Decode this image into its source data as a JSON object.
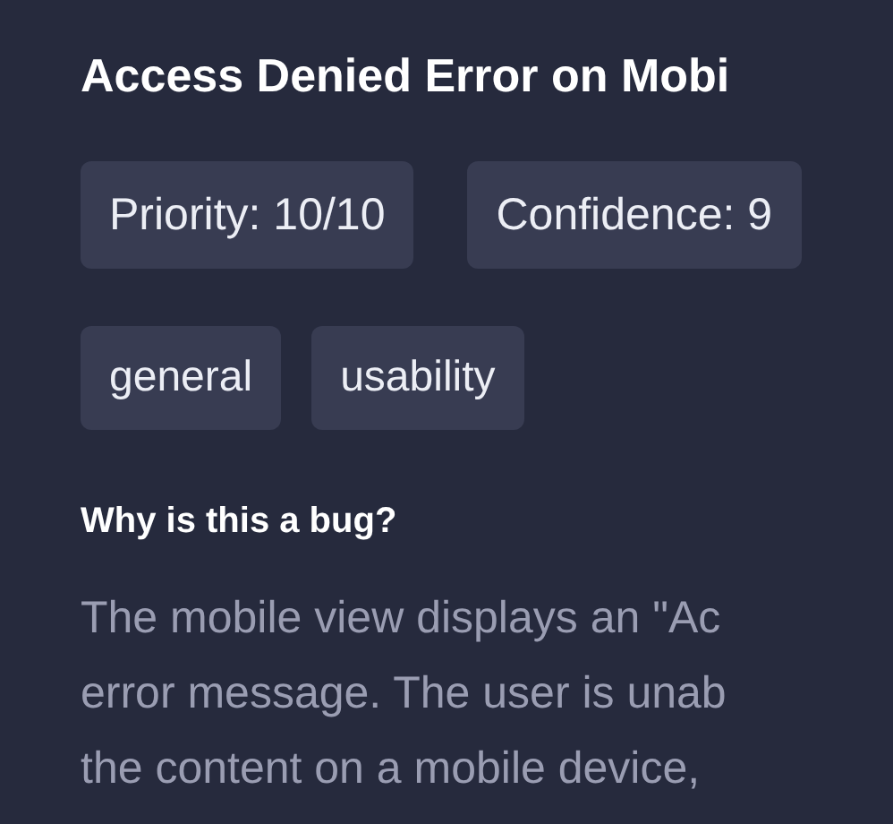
{
  "title": "Access Denied Error on Mobi",
  "badges": [
    "Priority: 10/10",
    "Confidence: 9"
  ],
  "tags": [
    "general",
    "usability"
  ],
  "section": {
    "heading": "Why is this a bug?",
    "lines": [
      "The mobile view displays an \"Ac",
      "error message. The user is unab",
      "the content on a mobile device,"
    ]
  }
}
